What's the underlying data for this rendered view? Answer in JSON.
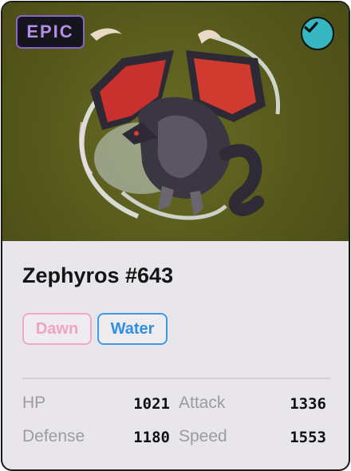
{
  "card": {
    "rarity": "EPIC",
    "owned": true,
    "name": "Zephyros #643",
    "tags": [
      {
        "label": "Dawn",
        "color": "#f2a2c3"
      },
      {
        "label": "Water",
        "color": "#2f8fe3"
      }
    ],
    "stats": [
      {
        "label": "HP",
        "value": "1021"
      },
      {
        "label": "Attack",
        "value": "1336"
      },
      {
        "label": "Defense",
        "value": "1180"
      },
      {
        "label": "Speed",
        "value": "1553"
      }
    ],
    "colors": {
      "art_background": "#5a5d1d",
      "rarity_accent": "#b290e6",
      "check_badge": "#36b6c0",
      "panel_background": "#e8e6ea"
    },
    "icons": [
      "check-icon",
      "creature-artwork"
    ]
  }
}
